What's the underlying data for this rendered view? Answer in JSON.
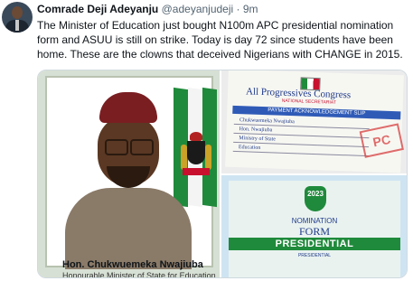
{
  "tweet": {
    "author_name": "Comrade Deji Adeyanju",
    "handle": "@adeyanjudeji",
    "separator": "·",
    "time": "9m",
    "text": "The Minister of Education just bought N100m APC presidential nomination form and ASUU is still on strike. Today is day 72 since students have been home. These are the clowns that deceived Nigerians with CHANGE in 2015."
  },
  "media": {
    "left_photo": {
      "caption_name": "Hon. Chukwuemeka Nwajiuba",
      "caption_title": "Honourable Minister of State for Education"
    },
    "top_right_photo": {
      "header": "All Progressives Congress",
      "subheader": "NATIONAL SECRETARIAT",
      "bar_text": "PAYMENT ACKNOWLEDGEMENT SLIP",
      "handwritten_lines": [
        "Chukwuemeka Nwajiuba",
        "Hon. Nwajiuba",
        "Ministry of State",
        "Education"
      ],
      "stamp_text": "PC"
    },
    "bottom_right_photo": {
      "year": "2023",
      "line1": "NOMINATION",
      "line2": "FORM",
      "band_text": "PRESIDENTIAL",
      "sub_text": "PRESIDENTIAL"
    }
  }
}
